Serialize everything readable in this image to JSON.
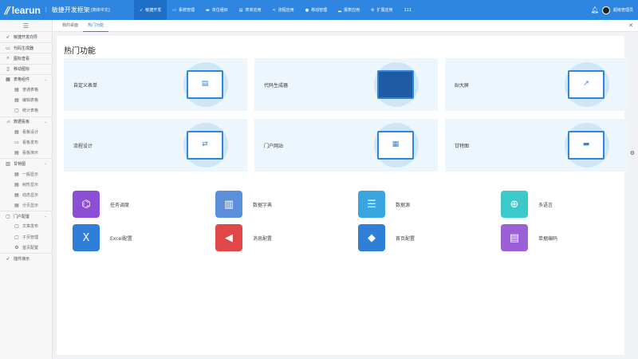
{
  "header": {
    "logo": "learun",
    "title": "敏捷开发框架",
    "subtitle": "[简体中文]",
    "nav": [
      {
        "label": "敏捷开发",
        "icon": "rocket-icon",
        "active": true
      },
      {
        "label": "系统管理",
        "icon": "monitor-icon"
      },
      {
        "label": "单位组织",
        "icon": "org-icon"
      },
      {
        "label": "表单应用",
        "icon": "form-icon"
      },
      {
        "label": "流程应用",
        "icon": "share-icon"
      },
      {
        "label": "移动管理",
        "icon": "mobile-icon"
      },
      {
        "label": "报表应用",
        "icon": "chart-icon"
      },
      {
        "label": "扩展应用",
        "icon": "extension-icon"
      },
      {
        "label": "111",
        "icon": ""
      }
    ],
    "user": "超级管理员"
  },
  "tabs": [
    {
      "label": "我的桌面"
    },
    {
      "label": "热门功能",
      "active": true
    }
  ],
  "sidebar": [
    {
      "label": "敏捷开发向导",
      "icon": "➶",
      "type": "item"
    },
    {
      "label": "代码生成器",
      "icon": "▭",
      "type": "grp"
    },
    {
      "label": "图标查看",
      "icon": "⌕",
      "type": "grp"
    },
    {
      "label": "移动图标",
      "icon": "▯",
      "type": "grp"
    },
    {
      "label": "表格组件",
      "icon": "▦",
      "type": "grp",
      "expand": true
    },
    {
      "label": "普通表格",
      "icon": "▤",
      "type": "sub"
    },
    {
      "label": "编辑表格",
      "icon": "▤",
      "type": "sub"
    },
    {
      "label": "统计表格",
      "icon": "▢",
      "type": "sub"
    },
    {
      "label": "数据看板",
      "icon": "⩘",
      "type": "grp",
      "expand": true
    },
    {
      "label": "看板设计",
      "icon": "▤",
      "type": "sub"
    },
    {
      "label": "看板发布",
      "icon": "▭",
      "type": "sub"
    },
    {
      "label": "看板演示",
      "icon": "▤",
      "type": "sub"
    },
    {
      "label": "甘特图",
      "icon": "▥",
      "type": "grp",
      "expand": true
    },
    {
      "label": "一般显示",
      "icon": "▤",
      "type": "sub"
    },
    {
      "label": "树形显示",
      "icon": "▤",
      "type": "sub"
    },
    {
      "label": "动态显示",
      "icon": "▤",
      "type": "sub"
    },
    {
      "label": "分页显示",
      "icon": "▤",
      "type": "sub"
    },
    {
      "label": "门户配置",
      "icon": "▢",
      "type": "grp",
      "expand": true
    },
    {
      "label": "文章发布",
      "icon": "▢",
      "type": "sub"
    },
    {
      "label": "子页管理",
      "icon": "▢",
      "type": "sub"
    },
    {
      "label": "首页配置",
      "icon": "⚙",
      "type": "sub"
    },
    {
      "label": "插件演示",
      "icon": "➶",
      "type": "grp"
    }
  ],
  "main": {
    "title": "热门功能",
    "cards": [
      {
        "label": "自定义表单",
        "art": "▤"
      },
      {
        "label": "代码生成器",
        "art": "</>"
      },
      {
        "label": "BI大屏",
        "art": "↗"
      },
      {
        "label": "流程设计",
        "art": "⇄"
      },
      {
        "label": "门户网站",
        "art": "▦"
      },
      {
        "label": "甘特图",
        "art": "▬"
      }
    ],
    "apps": [
      {
        "label": "任务调度",
        "color": "#8b4fd6",
        "icon": "⌬"
      },
      {
        "label": "数据字典",
        "color": "#5b8fdc",
        "icon": "▥"
      },
      {
        "label": "数据源",
        "color": "#3aa6e0",
        "icon": "☰"
      },
      {
        "label": "多语言",
        "color": "#3cc9c9",
        "icon": "⊕"
      },
      {
        "label": "Excel配置",
        "color": "#2f7fd8",
        "icon": "X"
      },
      {
        "label": "消息配置",
        "color": "#e04848",
        "icon": "◀"
      },
      {
        "label": "首页配置",
        "color": "#2f7fd8",
        "icon": "◆"
      },
      {
        "label": "单据编码",
        "color": "#9b5fd8",
        "icon": "▤"
      }
    ]
  }
}
